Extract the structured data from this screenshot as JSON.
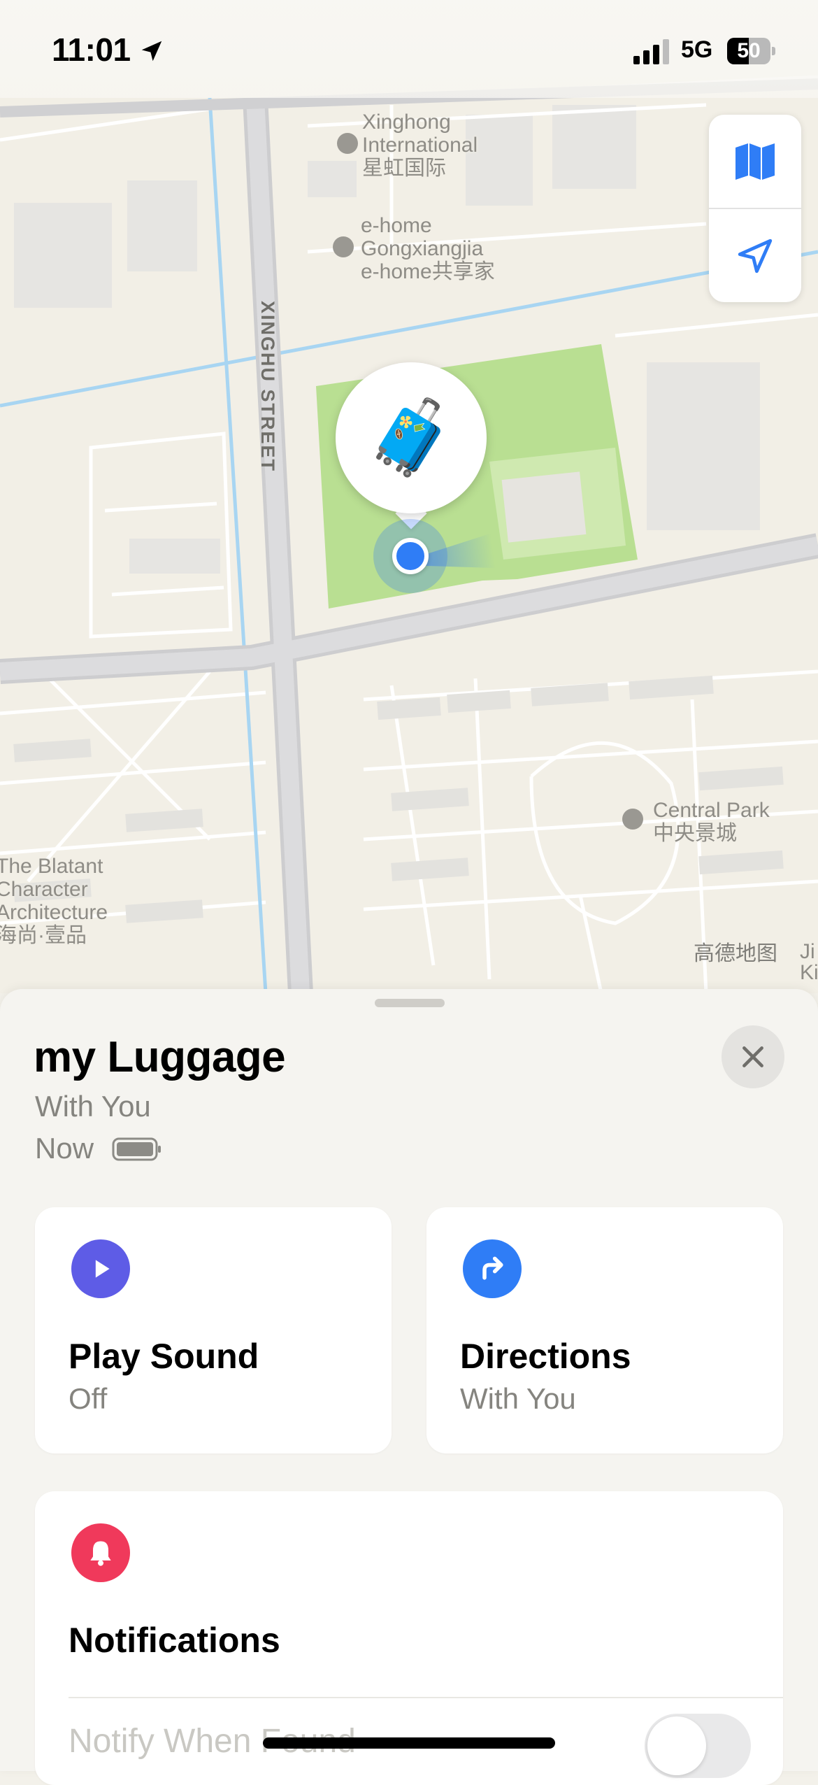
{
  "status_bar": {
    "time": "11:01",
    "network": "5G",
    "battery_level": "50"
  },
  "map": {
    "labels": {
      "xinghong": [
        "Xinghong",
        "International",
        "星虹国际"
      ],
      "ehome": [
        "e-home",
        "Gongxiangjia",
        "e-home共享家"
      ],
      "street": "XINGHU STREET",
      "central_park": [
        "Central Park",
        "中央景城"
      ],
      "blatant": [
        "The Blatant",
        "Character",
        "Architecture",
        "海尚·壹品"
      ],
      "amap": "高德地图",
      "edge": [
        "Ji",
        "Ki"
      ]
    },
    "pin_emoji": "🧳",
    "controls": {
      "map_mode_icon": "map-icon",
      "location_icon": "location-arrow-icon"
    }
  },
  "sheet": {
    "title": "my Luggage",
    "status": "With You",
    "time": "Now",
    "close_icon": "close-icon",
    "actions": [
      {
        "title": "Play Sound",
        "subtitle": "Off",
        "icon": "play-icon",
        "color": "#5e5ce6"
      },
      {
        "title": "Directions",
        "subtitle": "With You",
        "icon": "directions-arrow-icon",
        "color": "#2f7df6"
      }
    ],
    "notifications": {
      "title": "Notifications",
      "icon": "bell-icon",
      "color": "#f0395b",
      "row_label": "Notify When Found",
      "toggle_on": false
    }
  }
}
